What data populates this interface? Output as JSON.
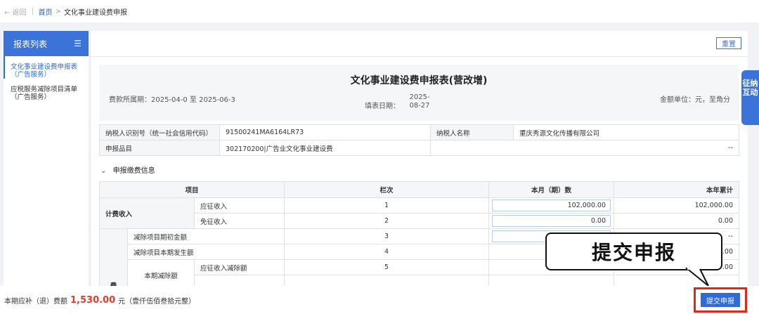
{
  "topbar": {
    "back": "← 返回",
    "home": "首页",
    "gt": ">",
    "current": "文化事业建设费申报"
  },
  "sidebar": {
    "title": "报表列表",
    "menu_icon": "☰",
    "items": [
      {
        "label": "文化事业建设费申报表（广告服务）"
      },
      {
        "label": "应税服务减除项目清单（广告服务）"
      }
    ]
  },
  "main": {
    "reset_label": "重置",
    "title": "文化事业建设费申报表(营改增)",
    "period": "费款所属期：2025-04-0 至 2025-06-3",
    "fill_date_label": "填表日期：",
    "fill_date_value": "2025-08-27",
    "unit": "金额单位：元，至角分"
  },
  "info": {
    "taxid_label": "纳税人识别号（统一社会信用代码）",
    "taxid_value": "91500241MA6164LR73",
    "name_label": "纳税人名称",
    "name_value": "重庆秀源文化传播有限公司",
    "item_label": "申报品目",
    "item_value": "302170200|广告业文化事业建设费",
    "item_extra": "--"
  },
  "section": {
    "chevron": "⌄",
    "title": "申报缴费信息"
  },
  "detail": {
    "headers": {
      "item": "项目",
      "col": "栏次",
      "month": "本月（期）数",
      "year": "本年累计"
    },
    "group1": "计费收入",
    "group2": "费",
    "sub_deduct": "本期减除额",
    "rows": [
      {
        "label": "应征收入",
        "col": "1",
        "month": "102,000.00",
        "year": "102,000.00"
      },
      {
        "label": "免征收入",
        "col": "2",
        "month": "0.00",
        "year": "0.00"
      },
      {
        "label": "减除项目期初金额",
        "col": "3",
        "month": "",
        "year": "--"
      },
      {
        "label": "减除项目本期发生额",
        "col": "4",
        "month": "",
        "year": ".00"
      },
      {
        "label": "应征收入减除额",
        "col": "5",
        "month": "0.00",
        "year": ".00"
      }
    ]
  },
  "side_tab": {
    "label": "征纳互动"
  },
  "callout": {
    "text": "提交申报"
  },
  "bottom": {
    "prefix": "本期应补（退）费额",
    "amount": "1,530.00",
    "suffix": "元（壹仟伍佰叁拾元整）",
    "submit": "提交申报"
  }
}
